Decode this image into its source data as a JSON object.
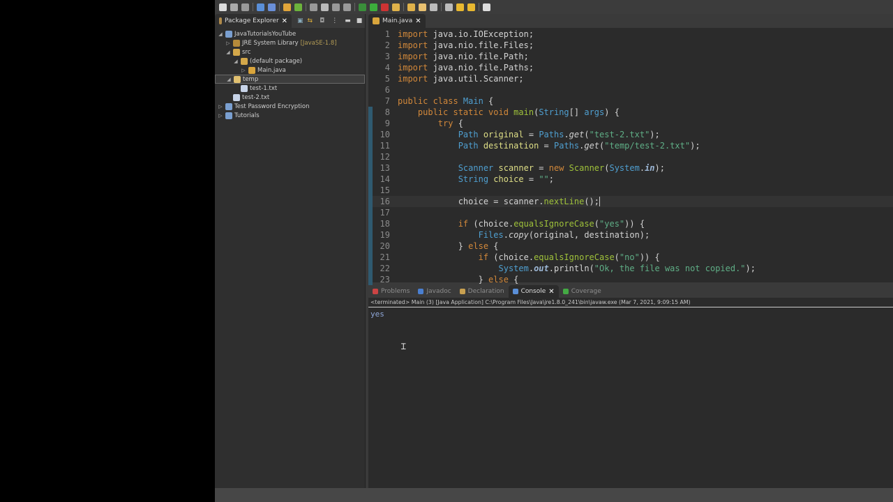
{
  "toolbar": {
    "icons": [
      "new-icon",
      "save-icon",
      "save-all-icon",
      "terminal-icon",
      "skip-breakpoints-icon",
      "new-java-project-icon",
      "new-class-icon",
      "toggle-mark-icon",
      "edit-icon",
      "whitespace-icon",
      "debug-icon",
      "run-icon",
      "coverage-icon",
      "external-tools-icon",
      "open-type-icon",
      "open-folder-icon",
      "search-icon",
      "next-annotation-icon",
      "prev-annotation-icon",
      "back-icon",
      "forward-icon",
      "open-perspective-icon"
    ]
  },
  "package_explorer": {
    "title": "Package Explorer",
    "tree": [
      {
        "label": "JavaTutorialsYouTube",
        "depth": 0,
        "arrow": "◢",
        "icon": "project-icon"
      },
      {
        "label": "JRE System Library",
        "decor": "[JavaSE-1.8]",
        "depth": 1,
        "arrow": "▷",
        "icon": "library-icon"
      },
      {
        "label": "src",
        "depth": 1,
        "arrow": "◢",
        "icon": "source-folder-icon"
      },
      {
        "label": "(default package)",
        "depth": 2,
        "arrow": "◢",
        "icon": "package-icon"
      },
      {
        "label": "Main.java",
        "depth": 3,
        "arrow": "▷",
        "icon": "java-file-icon"
      },
      {
        "label": "temp",
        "depth": 1,
        "arrow": "◢",
        "icon": "folder-icon",
        "selected": true
      },
      {
        "label": "test-1.txt",
        "depth": 2,
        "arrow": "",
        "icon": "text-file-icon"
      },
      {
        "label": "test-2.txt",
        "depth": 1,
        "arrow": "",
        "icon": "text-file-icon"
      },
      {
        "label": "Test Password Encryption",
        "depth": 0,
        "arrow": "▷",
        "icon": "project-icon"
      },
      {
        "label": "Tutorials",
        "depth": 0,
        "arrow": "▷",
        "icon": "project-icon"
      }
    ]
  },
  "editor": {
    "tab": "Main.java",
    "lines": [
      [
        [
          "import",
          "kw"
        ],
        [
          " java.io.IOException;",
          ""
        ]
      ],
      [
        [
          "import",
          "kw"
        ],
        [
          " java.nio.file.Files;",
          ""
        ]
      ],
      [
        [
          "import",
          "kw"
        ],
        [
          " java.nio.file.Path;",
          ""
        ]
      ],
      [
        [
          "import",
          "kw"
        ],
        [
          " java.nio.file.Paths;",
          ""
        ]
      ],
      [
        [
          "import",
          "kw"
        ],
        [
          " java.util.Scanner;",
          ""
        ]
      ],
      [],
      [
        [
          "public class ",
          "kw"
        ],
        [
          "Main",
          "ty"
        ],
        [
          " {",
          ""
        ]
      ],
      [
        [
          "    public static void ",
          "kw"
        ],
        [
          "main",
          "fn"
        ],
        [
          "(",
          ""
        ],
        [
          "String",
          "ty"
        ],
        [
          "[] ",
          ""
        ],
        [
          "args",
          "ty"
        ],
        [
          ") {",
          ""
        ]
      ],
      [
        [
          "        try",
          "kw"
        ],
        [
          " {",
          ""
        ]
      ],
      [
        [
          "            Path ",
          "ty"
        ],
        [
          "original",
          "va"
        ],
        [
          " = ",
          ""
        ],
        [
          "Paths",
          "ty"
        ],
        [
          ".",
          ""
        ],
        [
          "get",
          "it"
        ],
        [
          "(",
          ""
        ],
        [
          "\"test-2.txt\"",
          "st"
        ],
        [
          ");",
          ""
        ]
      ],
      [
        [
          "            Path ",
          "ty"
        ],
        [
          "destination",
          "va"
        ],
        [
          " = ",
          ""
        ],
        [
          "Paths",
          "ty"
        ],
        [
          ".",
          ""
        ],
        [
          "get",
          "it"
        ],
        [
          "(",
          ""
        ],
        [
          "\"temp/test-2.txt\"",
          "st"
        ],
        [
          ");",
          ""
        ]
      ],
      [],
      [
        [
          "            Scanner ",
          "ty"
        ],
        [
          "scanner",
          "va"
        ],
        [
          " = ",
          ""
        ],
        [
          "new ",
          "kw"
        ],
        [
          "Scanner",
          "fn"
        ],
        [
          "(",
          ""
        ],
        [
          "System",
          "ty"
        ],
        [
          ".",
          ""
        ],
        [
          "in",
          "sf"
        ],
        [
          ");",
          ""
        ]
      ],
      [
        [
          "            String ",
          "ty"
        ],
        [
          "choice",
          "va"
        ],
        [
          " = ",
          ""
        ],
        [
          "\"\"",
          "st"
        ],
        [
          ";",
          ""
        ]
      ],
      [],
      [
        [
          "            choice = scanner.",
          ""
        ],
        [
          "nextLine",
          "fn"
        ],
        [
          "();",
          ""
        ]
      ],
      [],
      [
        [
          "            if",
          "kw"
        ],
        [
          " (choice.",
          ""
        ],
        [
          "equalsIgnoreCase",
          "fn"
        ],
        [
          "(",
          ""
        ],
        [
          "\"yes\"",
          "st"
        ],
        [
          ")) {",
          ""
        ]
      ],
      [
        [
          "                Files",
          "ty"
        ],
        [
          ".",
          ""
        ],
        [
          "copy",
          "it"
        ],
        [
          "(original, destination);",
          ""
        ]
      ],
      [
        [
          "            } ",
          ""
        ],
        [
          "else",
          "kw"
        ],
        [
          " {",
          ""
        ]
      ],
      [
        [
          "                if",
          "kw"
        ],
        [
          " (choice.",
          ""
        ],
        [
          "equalsIgnoreCase",
          "fn"
        ],
        [
          "(",
          ""
        ],
        [
          "\"no\"",
          "st"
        ],
        [
          ")) {",
          ""
        ]
      ],
      [
        [
          "                    System",
          "ty"
        ],
        [
          ".",
          ""
        ],
        [
          "out",
          "sf"
        ],
        [
          ".println(",
          ""
        ],
        [
          "\"Ok, the file was not copied.\"",
          "st"
        ],
        [
          ");",
          ""
        ]
      ],
      [
        [
          "                } ",
          ""
        ],
        [
          "else",
          "kw"
        ],
        [
          " {",
          ""
        ]
      ]
    ]
  },
  "console": {
    "tabs": [
      "Problems",
      "Javadoc",
      "Declaration",
      "Console",
      "Coverage"
    ],
    "active": "Console",
    "header": "<terminated> Main (3) [Java Application] C:\\Program Files\\Java\\jre1.8.0_241\\bin\\javaw.exe (Mar 7, 2021, 9:09:15 AM)",
    "output": "yes"
  }
}
